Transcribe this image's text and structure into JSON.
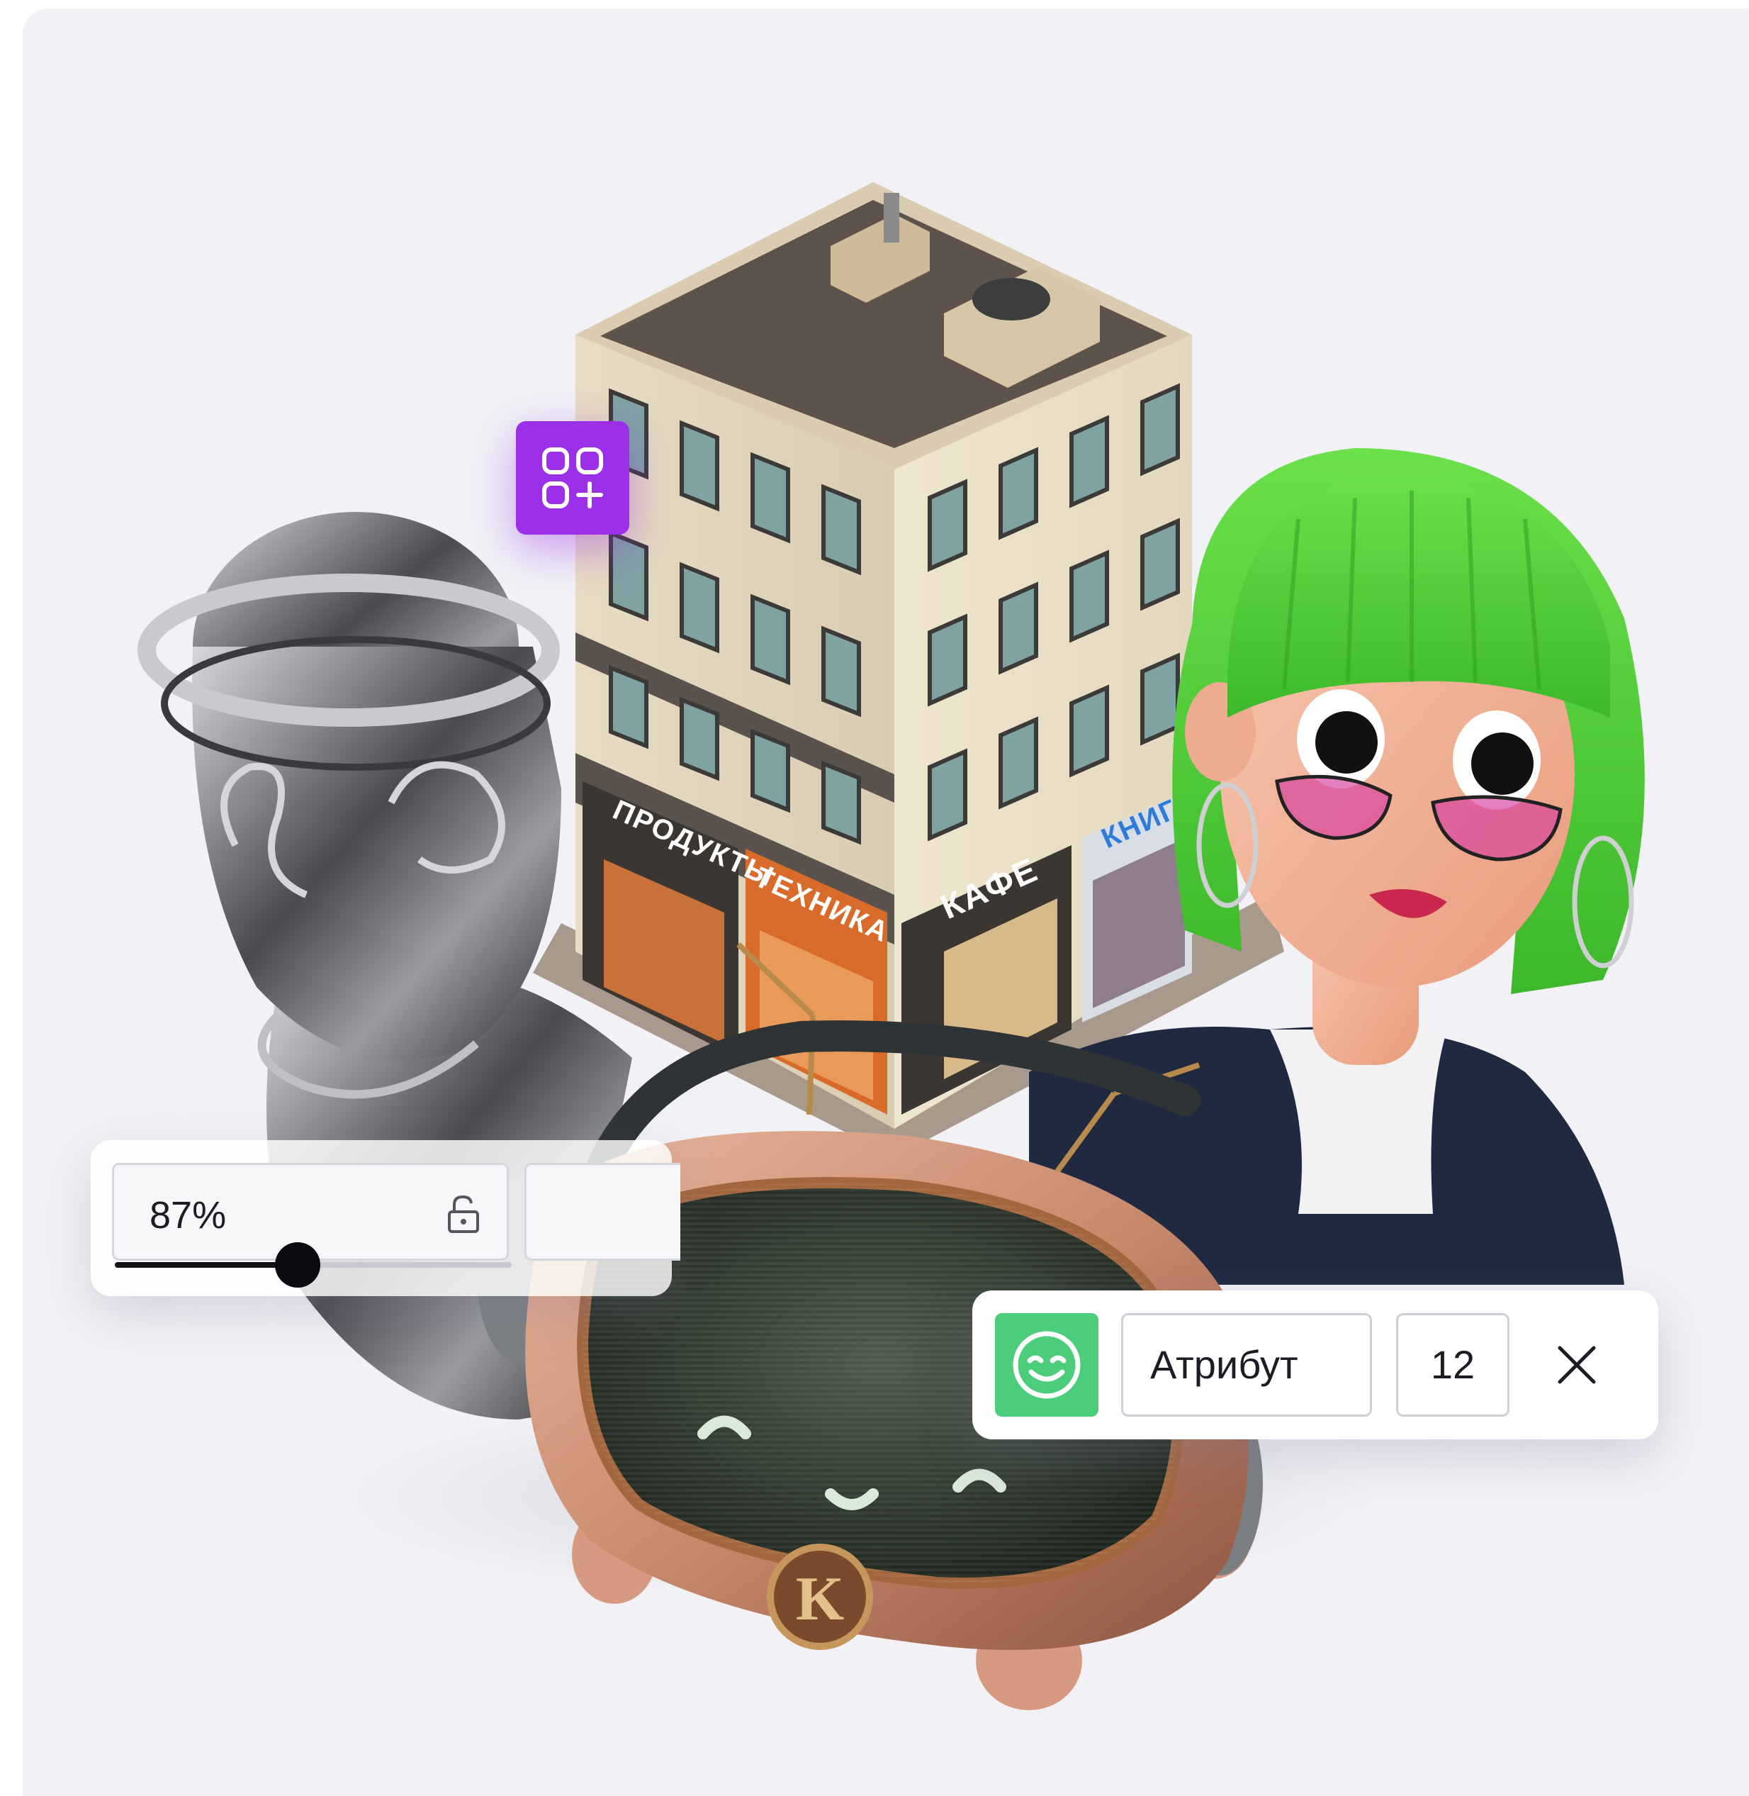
{
  "opacity": {
    "value_label": "87%",
    "level": 0.87
  },
  "attribute_row": {
    "name": "Атрибут",
    "count": "12"
  },
  "building_signs": {
    "groceries": "ПРОДУКТЫ",
    "electronics": "ТЕХНИКА",
    "cafe": "КАФЕ",
    "books": "КНИГИ"
  },
  "robot_badge": "K",
  "icons": {
    "add_widget": "add-widget-icon",
    "lock": "unlock-icon",
    "smile": "smile-icon",
    "close": "close-icon"
  },
  "colors": {
    "background": "#f1f1f6",
    "accent_purple": "#9b30e8",
    "accent_green": "#4ccd7b",
    "hair_green": "#4fd93a"
  }
}
